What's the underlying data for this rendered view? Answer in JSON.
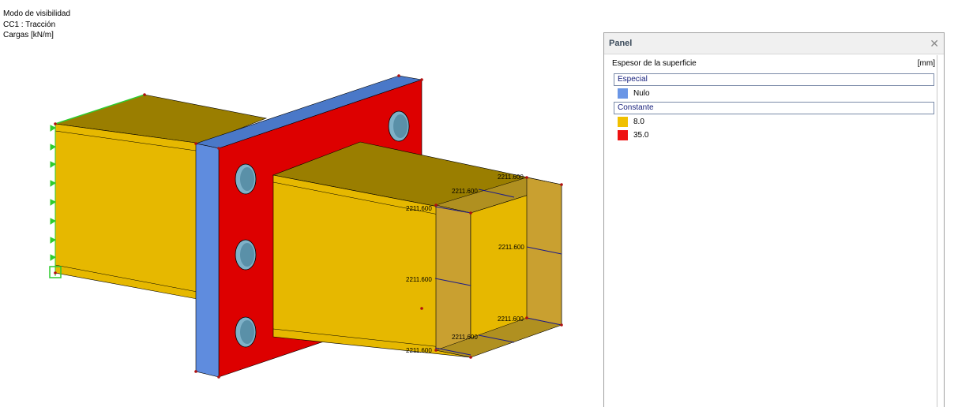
{
  "viewport": {
    "info_lines": [
      "Modo de visibilidad",
      "CC1 : Tracción",
      "Cargas [kN/m]"
    ],
    "dimension_label": "2211.600",
    "colors": {
      "beam": "#e6b800",
      "beam_dark": "#9a7e00",
      "plate_face": "#dd0000",
      "plate_edge": "#5f8cde",
      "bolt_hole": "#7fb1c8",
      "support": "#2ecc2e",
      "node": "#b01010"
    }
  },
  "panel": {
    "title": "Panel",
    "close_icon": "close-icon",
    "surface_label": "Espesor de la superficie",
    "unit": "[mm]",
    "groups": [
      {
        "header": "Especial",
        "items": [
          {
            "label": "Nulo",
            "color": "#6a96e6"
          }
        ]
      },
      {
        "header": "Constante",
        "items": [
          {
            "label": "8.0",
            "color": "#f0c000"
          },
          {
            "label": "35.0",
            "color": "#ee1111"
          }
        ]
      }
    ]
  }
}
